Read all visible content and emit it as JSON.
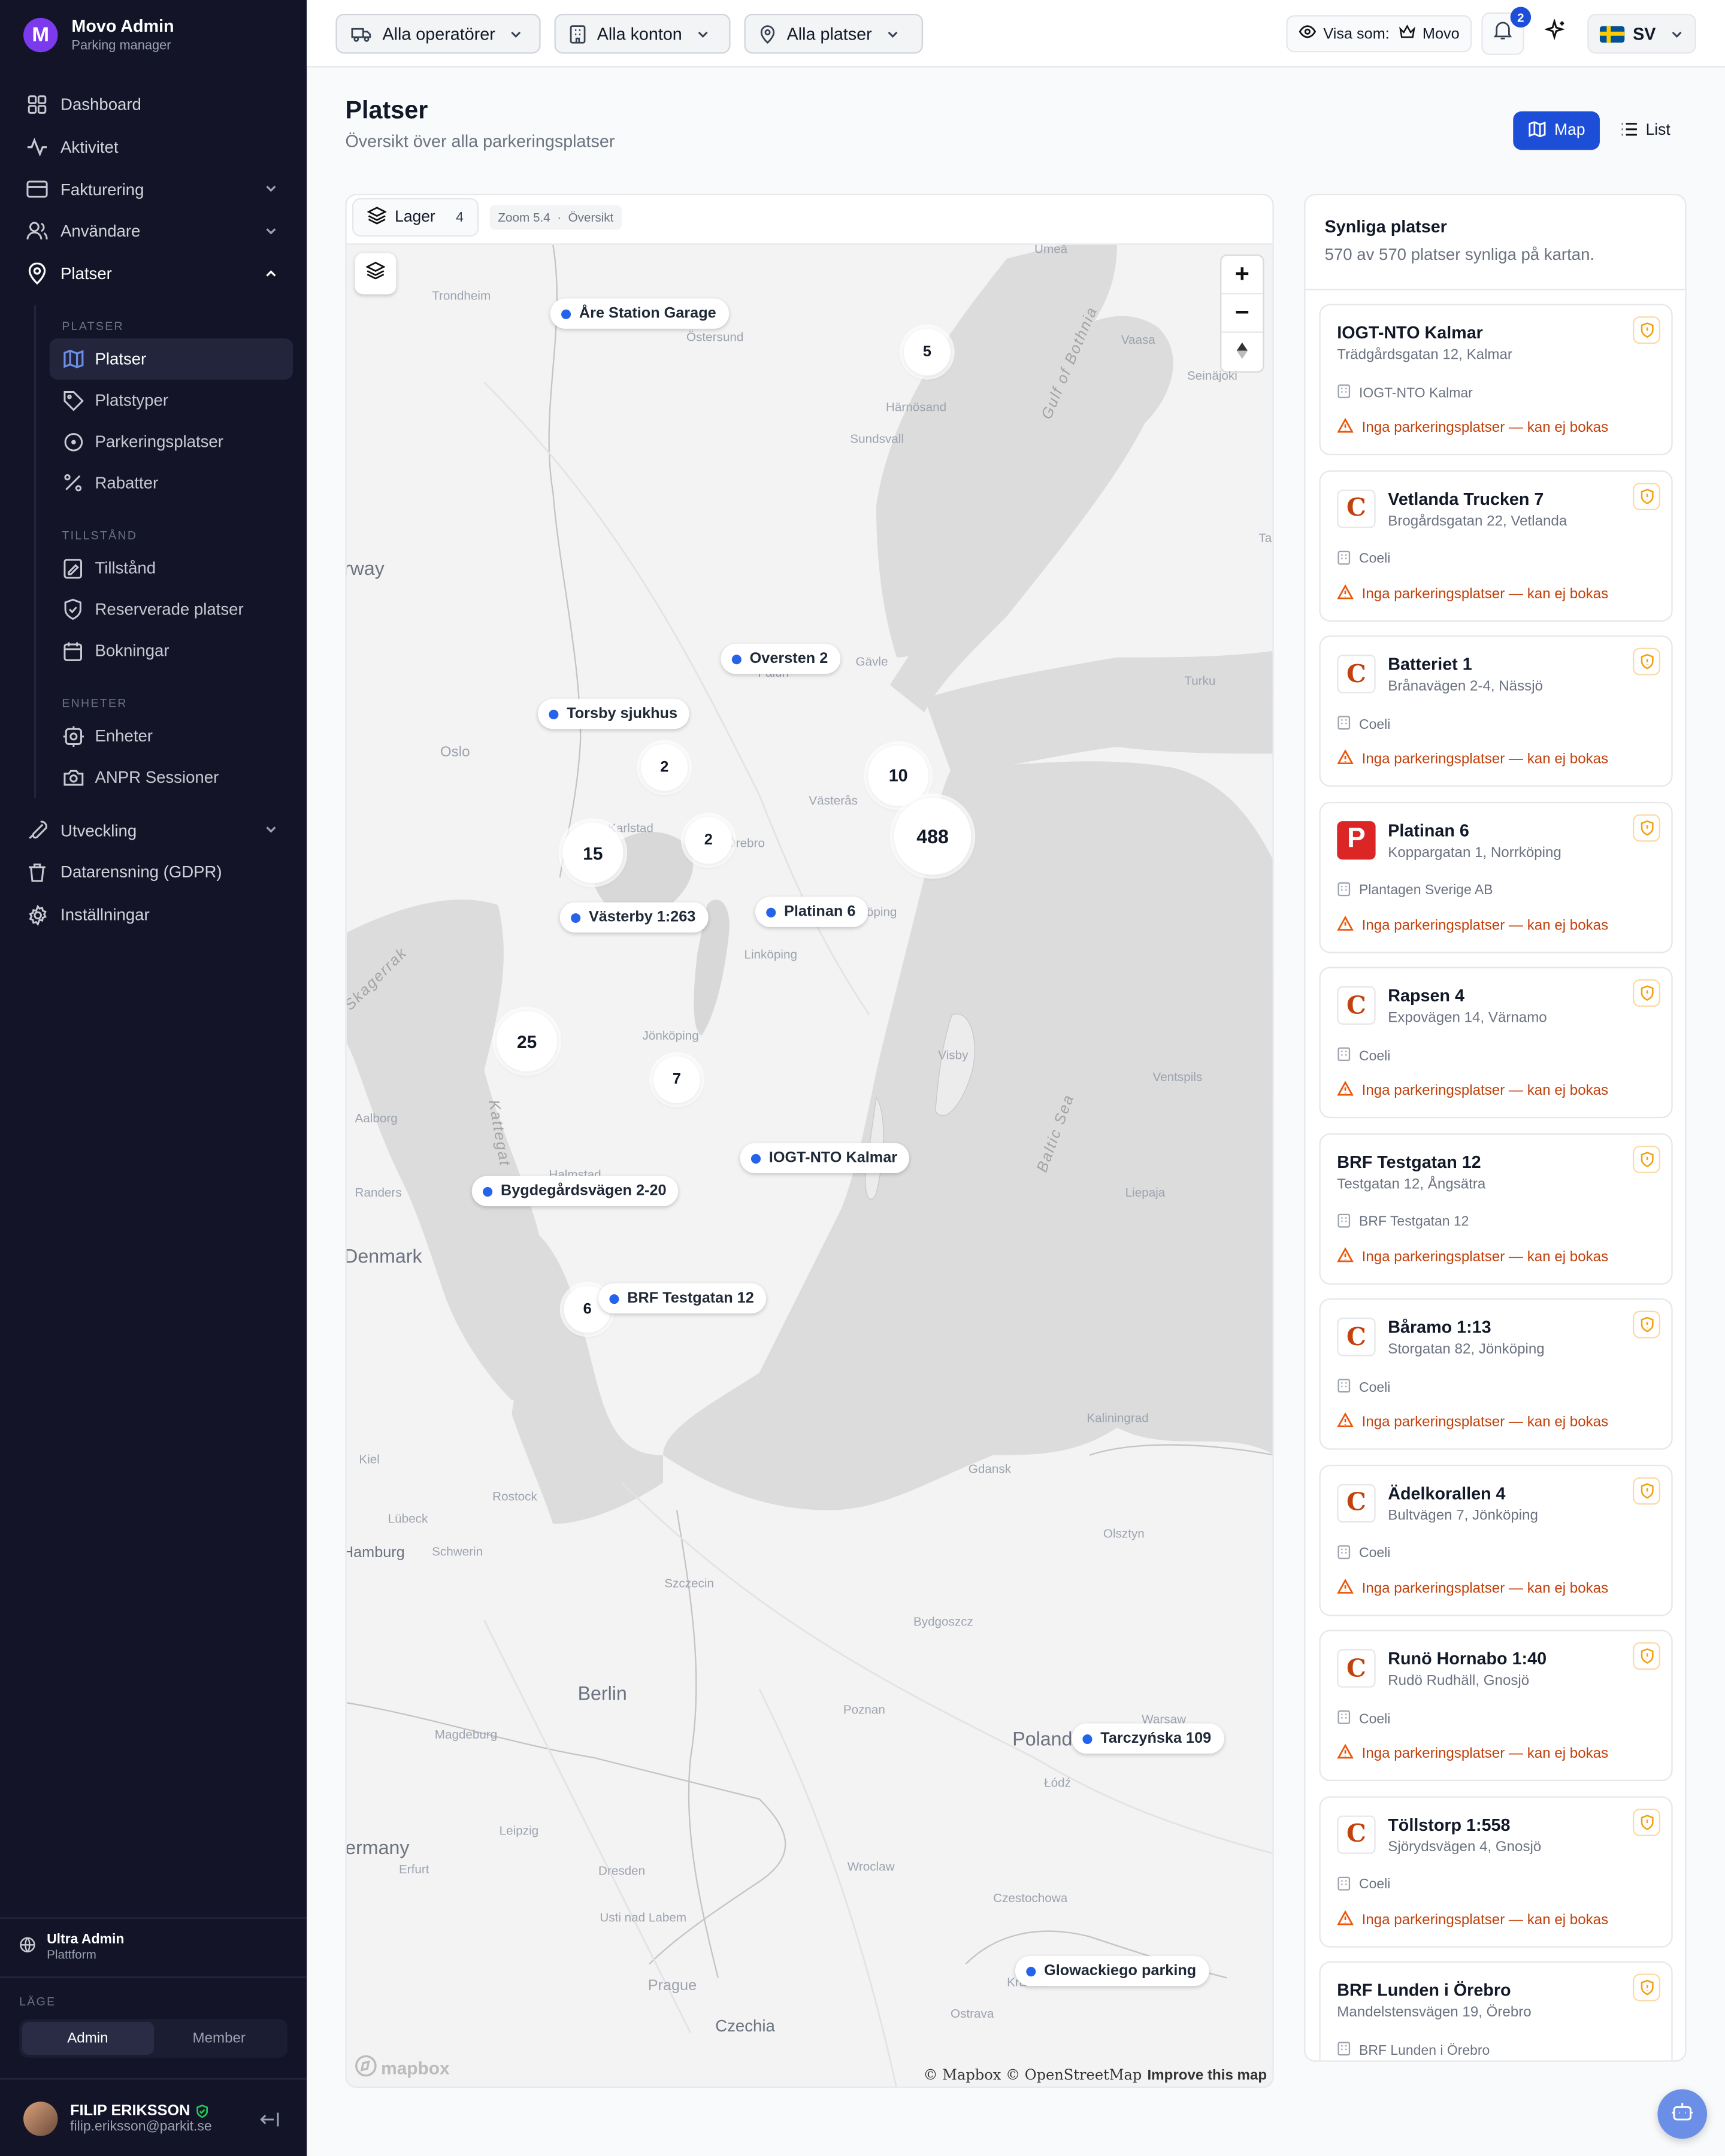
{
  "app": {
    "title": "Movo Admin",
    "subtitle": "Parking manager",
    "logo_letter": "M"
  },
  "sidebar": {
    "top_items": [
      {
        "label": "Dashboard",
        "icon": "grid-icon"
      },
      {
        "label": "Aktivitet",
        "icon": "activity-icon"
      },
      {
        "label": "Fakturering",
        "icon": "card-icon",
        "expandable": true
      },
      {
        "label": "Användare",
        "icon": "users-icon",
        "expandable": true
      },
      {
        "label": "Platser",
        "icon": "map-pin-icon",
        "expandable": true,
        "open": true
      }
    ],
    "platser_section": "PLATSER",
    "platser_items": [
      {
        "label": "Platser",
        "icon": "map-icon",
        "active": true
      },
      {
        "label": "Platstyper",
        "icon": "tag-icon"
      },
      {
        "label": "Parkeringsplatser",
        "icon": "circle-dot-icon"
      },
      {
        "label": "Rabatter",
        "icon": "percent-icon"
      }
    ],
    "tillstand_section": "TILLSTÅND",
    "tillstand_items": [
      {
        "label": "Tillstånd",
        "icon": "file-edit-icon"
      },
      {
        "label": "Reserverade platser",
        "icon": "shield-check-icon"
      },
      {
        "label": "Bokningar",
        "icon": "calendar-icon"
      }
    ],
    "enheter_section": "ENHETER",
    "enheter_items": [
      {
        "label": "Enheter",
        "icon": "cog-box-icon"
      },
      {
        "label": "ANPR Sessioner",
        "icon": "camera-icon"
      }
    ],
    "bottom_items": [
      {
        "label": "Utveckling",
        "icon": "wrench-icon",
        "expandable": true
      },
      {
        "label": "Datarensning (GDPR)",
        "icon": "trash-icon"
      },
      {
        "label": "Inställningar",
        "icon": "settings-icon"
      }
    ],
    "org": {
      "name": "Ultra Admin",
      "type": "Plattform"
    },
    "mode": {
      "label": "LÄGE",
      "options": [
        "Admin",
        "Member"
      ],
      "selected": "Admin"
    },
    "user": {
      "name": "FILIP ERIKSSON",
      "email": "filip.eriksson@parkit.se"
    }
  },
  "topbar": {
    "filters": [
      "Alla operatörer",
      "Alla konton",
      "Alla platser"
    ],
    "view_as_label": "Visa som:",
    "view_as_value": "Movo",
    "notifications_count": "2",
    "language": "SV"
  },
  "page": {
    "title": "Platser",
    "subtitle": "Översikt över alla parkeringsplatser",
    "view_options": [
      "Map",
      "List"
    ],
    "active_view": "Map"
  },
  "map": {
    "layers_label": "Lager",
    "layers_count": "4",
    "zoom_text": "Zoom 5.4",
    "zoom_mode": "Översikt",
    "attribution": "© Mapbox © OpenStreetMap",
    "improve_link": "Improve this map",
    "brand": "mapbox",
    "pins": [
      "Åre Station Garage",
      "Oversten 2",
      "Torsby sjukhus",
      "Västerby 1:263",
      "Platinan 6",
      "IOGT-NTO Kalmar",
      "Bygdegårdsvägen 2-20",
      "BRF Testgatan 12",
      "Tarczyńska 109",
      "Glowackiego parking"
    ],
    "clusters": [
      "5",
      "10",
      "488",
      "2",
      "2",
      "15",
      "25",
      "7",
      "6"
    ],
    "place_labels": [
      "Umeå",
      "Trondheim",
      "Östersund",
      "Vaasa",
      "Seinäjoki",
      "Härnösand",
      "Sundsvall",
      "Gulf of Bothnia",
      "Falun",
      "Gävle",
      "Turku",
      "Oslo",
      "Karlstad",
      "Örebro",
      "Västerås",
      "Norrköping",
      "Linköping",
      "Skagerrak",
      "Jönköping",
      "Visby",
      "Ventspils",
      "Aalborg",
      "Kattegat",
      "Halmstad",
      "Baltic Sea",
      "Randers",
      "Liepaja",
      "Denmark",
      "Kaliningrad",
      "Kiel",
      "Rostock",
      "Gdansk",
      "Lübeck",
      "Schwerin",
      "Olsztyn",
      "Hamburg",
      "Szczecin",
      "Bydgoszcz",
      "Berlin",
      "Magdeburg",
      "Poznan",
      "Warsaw",
      "Poland",
      "Łódź",
      "Germany",
      "Leipzig",
      "Erfurt",
      "Dresden",
      "Wroclaw",
      "Usti nad Labem",
      "Czestochowa",
      "Kraków",
      "Prague",
      "Ostrava",
      "Czechia",
      "Norway",
      "Tallinn"
    ]
  },
  "panel": {
    "title": "Synliga platser",
    "subtitle": "570 av 570 platser synliga på kartan.",
    "warning": "Inga parkeringsplatser — kan ej bokas",
    "cards": [
      {
        "name": "IOGT-NTO Kalmar",
        "address": "Trädgårdsgatan 12, Kalmar",
        "owner": "IOGT-NTO Kalmar",
        "logo": "none"
      },
      {
        "name": "Vetlanda Trucken 7",
        "address": "Brogårdsgatan 22, Vetlanda",
        "owner": "Coeli",
        "logo": "coeli"
      },
      {
        "name": "Batteriet 1",
        "address": "Brånavägen 2-4, Nässjö",
        "owner": "Coeli",
        "logo": "coeli"
      },
      {
        "name": "Platinan 6",
        "address": "Koppargatan 1, Norrköping",
        "owner": "Plantagen Sverige AB",
        "logo": "plantagen"
      },
      {
        "name": "Rapsen 4",
        "address": "Expovägen 14, Värnamo",
        "owner": "Coeli",
        "logo": "coeli"
      },
      {
        "name": "BRF Testgatan 12",
        "address": "Testgatan 12, Ångsätra",
        "owner": "BRF Testgatan 12",
        "logo": "none"
      },
      {
        "name": "Båramo 1:13",
        "address": "Storgatan 82, Jönköping",
        "owner": "Coeli",
        "logo": "coeli"
      },
      {
        "name": "Ädelkorallen 4",
        "address": "Bultvägen 7, Jönköping",
        "owner": "Coeli",
        "logo": "coeli"
      },
      {
        "name": "Runö Hornabo 1:40",
        "address": "Rudö Rudhäll, Gnosjö",
        "owner": "Coeli",
        "logo": "coeli"
      },
      {
        "name": "Töllstorp 1:558",
        "address": "Sjörydsvägen 4, Gnosjö",
        "owner": "Coeli",
        "logo": "coeli"
      },
      {
        "name": "BRF Lunden i Örebro",
        "address": "Mandelstensvägen 19, Örebro",
        "owner": "BRF Lunden i Örebro",
        "logo": "none"
      }
    ]
  }
}
